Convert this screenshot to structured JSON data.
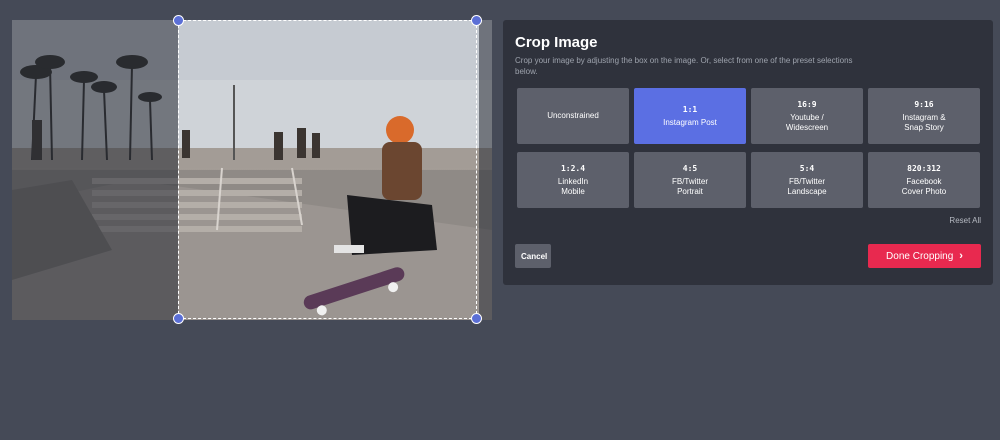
{
  "panel": {
    "title": "Crop Image",
    "description": "Crop your image by adjusting the box on the image. Or, select from one of the preset selections below."
  },
  "presets": [
    {
      "ratio": "",
      "label": "Unconstrained",
      "active": false
    },
    {
      "ratio": "1:1",
      "label": "Instagram Post",
      "active": true
    },
    {
      "ratio": "16:9",
      "label": "Youtube /\nWidescreen",
      "active": false
    },
    {
      "ratio": "9:16",
      "label": "Instagram &\nSnap Story",
      "active": false
    },
    {
      "ratio": "1:2.4",
      "label": "LinkedIn\nMobile",
      "active": false
    },
    {
      "ratio": "4:5",
      "label": "FB/Twitter\nPortrait",
      "active": false
    },
    {
      "ratio": "5:4",
      "label": "FB/Twitter\nLandscape",
      "active": false
    },
    {
      "ratio": "820:312",
      "label": "Facebook\nCover Photo",
      "active": false
    }
  ],
  "actions": {
    "reset_all": "Reset All",
    "cancel": "Cancel",
    "done": "Done Cropping"
  },
  "icons": {
    "done_chevron": "chevron-right-icon"
  },
  "colors": {
    "background": "#454a57",
    "panel": "#2f323c",
    "preset": "#5d606b",
    "preset_active": "#5b6fe3",
    "done_button": "#e8294f",
    "crop_handle": "#5b6fd6"
  }
}
